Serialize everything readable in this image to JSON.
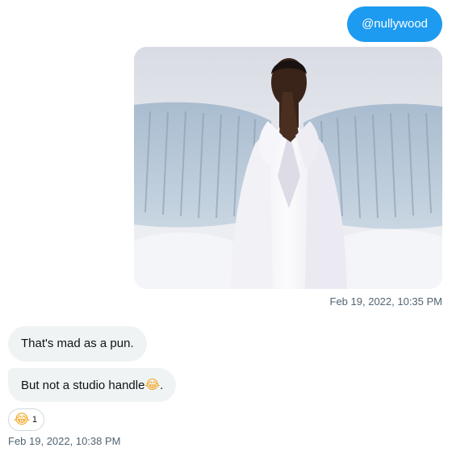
{
  "conversation": {
    "outgoing": {
      "text": "@nullywood",
      "timestamp": "Feb 19, 2022, 10:35 PM",
      "bubble_color": "#1d9bf0"
    },
    "incoming": {
      "messages": [
        {
          "text": "That's mad as a pun."
        },
        {
          "text": "But not a studio handle",
          "emoji": "😂",
          "suffix": "."
        }
      ],
      "reaction": {
        "emoji": "😂",
        "count": "1"
      },
      "timestamp": "Feb 19, 2022, 10:38 PM",
      "bubble_color": "#eff3f4"
    }
  },
  "colors": {
    "accent": "#1d9bf0",
    "muted_text": "#536471",
    "text": "#0f1419"
  }
}
